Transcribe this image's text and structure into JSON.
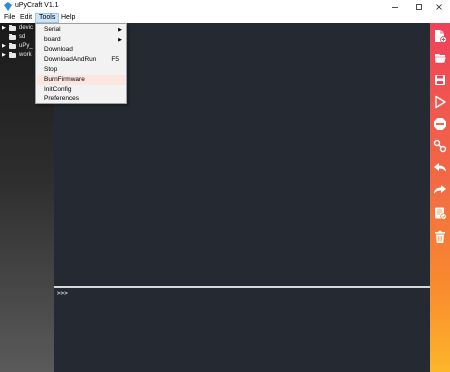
{
  "window": {
    "title": "uPyCraft V1.1"
  },
  "menubar": {
    "file": "File",
    "edit": "Edit",
    "tools": "Tools",
    "help": "Help"
  },
  "tools_menu": {
    "items": [
      {
        "label": "Serial",
        "submenu": true
      },
      {
        "label": "board",
        "submenu": true
      },
      {
        "label": "Download"
      },
      {
        "label": "DownloadAndRun",
        "shortcut": "F5"
      },
      {
        "label": "Stop"
      },
      {
        "label": "BurnFirmware",
        "highlighted": true
      },
      {
        "label": "InitConfig"
      },
      {
        "label": "Preferences"
      }
    ]
  },
  "file_tree": {
    "items": [
      {
        "label": "devic",
        "expandable": true
      },
      {
        "label": "sd",
        "expandable": false
      },
      {
        "label": "uPy_",
        "expandable": true
      },
      {
        "label": "work",
        "expandable": true
      }
    ]
  },
  "terminal": {
    "prompt": ">>>"
  },
  "toolbar": {
    "tools": [
      "new-file-icon",
      "open-file-icon",
      "save-icon",
      "run-icon",
      "stop-icon",
      "connect-icon",
      "undo-icon",
      "redo-icon",
      "syntax-check-icon",
      "clear-icon"
    ]
  },
  "colors": {
    "accent_top": "#f0405a",
    "accent_bottom": "#fdb62a",
    "editor_bg": "#252a32",
    "menu_highlight": "#fbe7df"
  }
}
